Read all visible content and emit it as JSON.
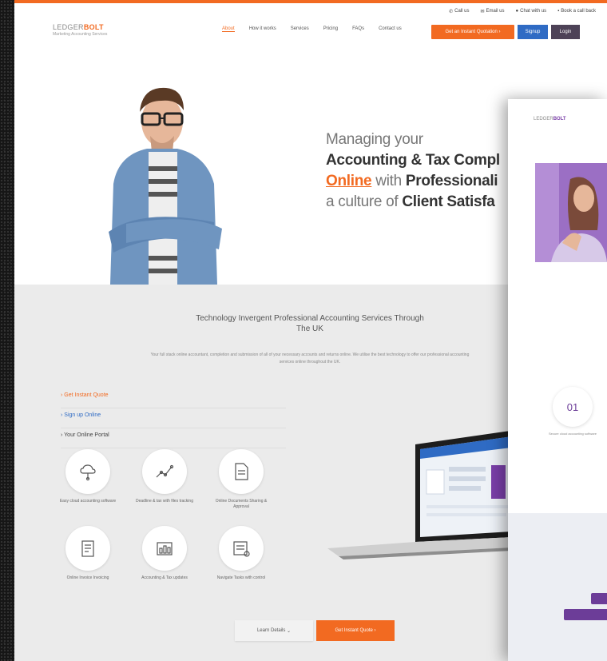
{
  "utility_bar": {
    "items": [
      {
        "icon": "phone-icon",
        "label": "Call us"
      },
      {
        "icon": "mail-icon",
        "label": "Email us"
      },
      {
        "icon": "chat-icon",
        "label": "Chat with us"
      },
      {
        "icon": "calendar-icon",
        "label": "Book a call back"
      }
    ]
  },
  "brand": {
    "name_a": "LEDGER",
    "name_b": "BOLT",
    "tagline": "Marketing Accounting Services"
  },
  "nav": {
    "items": [
      "About",
      "How it works",
      "Services",
      "Pricing",
      "FAQs",
      "Contact us"
    ],
    "active_index": 0
  },
  "header_buttons": {
    "quote": "Get an Instant Quotation",
    "signup": "Signup",
    "login": "Login"
  },
  "hero": {
    "line1": "Managing your",
    "line2": "Accounting & Tax Compl",
    "line3_a": "Online",
    "line3_b": " with ",
    "line3_c": "Professionali",
    "line4_a": "a culture of ",
    "line4_b": "Client Satisfa"
  },
  "services": {
    "title": "Technology Invergent Professional Accounting Services Through The UK",
    "description": "Your full stack online accountant, completion and submission of all of your necessary accounts and returns online. We utilise the best technology to offer our professional accounting services online throughout the UK.",
    "links": [
      {
        "label": "Get Instant Quote",
        "style": "orange"
      },
      {
        "label": "Sign up Online",
        "style": "blue"
      },
      {
        "label": "Your Online Portal",
        "style": "dark"
      }
    ],
    "features": [
      {
        "icon": "cloud-icon",
        "label": "Easy cloud accounting software"
      },
      {
        "icon": "graph-icon",
        "label": "Deadline & tax with files tracking"
      },
      {
        "icon": "document-icon",
        "label": "Online Documents Sharing & Approval"
      },
      {
        "icon": "invoice-icon",
        "label": "Online Invoice Invoicing"
      },
      {
        "icon": "report-icon",
        "label": "Accounting & Tax updates"
      },
      {
        "icon": "navigate-icon",
        "label": "Navigate Tasks with control"
      }
    ],
    "cta_details": "Learn Details",
    "cta_quote": "Get Instant Quote"
  },
  "second_page": {
    "logo_a": "LEDGER",
    "logo_b": "BOLT",
    "step_number": "01",
    "step_label": "Secure cloud accounting software"
  },
  "colors": {
    "accent": "#f26a21",
    "blue": "#2f6bc4",
    "purple": "#6c3d98",
    "login": "#4d4257"
  }
}
